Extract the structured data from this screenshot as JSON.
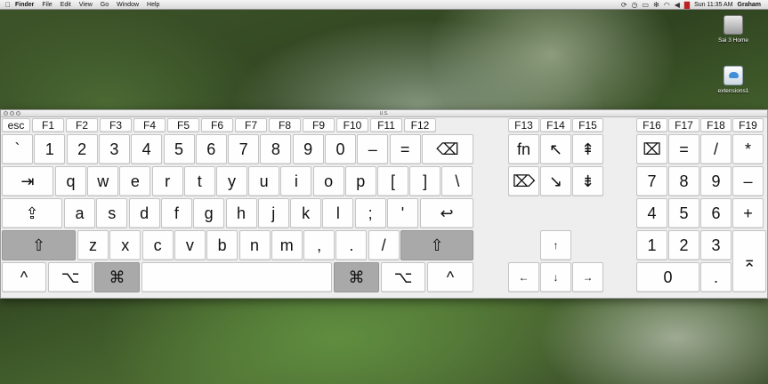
{
  "menubar": {
    "apple": "",
    "items": [
      "Finder",
      "File",
      "Edit",
      "View",
      "Go",
      "Window",
      "Help"
    ],
    "right_icons": [
      "sync-icon",
      "clock-icon",
      "display-icon",
      "bluetooth-icon",
      "wifi-icon",
      "volume-icon",
      "flag-icon"
    ],
    "right_glyphs": [
      "⟳",
      "◷",
      "▭",
      "✻",
      "◠",
      "◀",
      "▇"
    ],
    "time": "Sun 11:35 AM",
    "user": "Graham"
  },
  "desktop": {
    "icons": [
      {
        "label": "Sai 3 Home",
        "icon": "hard-drive-icon"
      },
      {
        "label": "extensions1",
        "icon": "icloud-drive-icon"
      }
    ]
  },
  "keyboard": {
    "title": "U.S.",
    "fn_row_main": [
      "esc",
      "F1",
      "F2",
      "F3",
      "F4",
      "F5",
      "F6",
      "F7",
      "F8",
      "F9",
      "F10",
      "F11",
      "F12"
    ],
    "fn_row_mid": [
      "F13",
      "F14",
      "F15"
    ],
    "fn_row_pad": [
      "F16",
      "F17",
      "F18",
      "F19"
    ],
    "row1": [
      "`",
      "1",
      "2",
      "3",
      "4",
      "5",
      "6",
      "7",
      "8",
      "9",
      "0",
      "–",
      "=",
      "⌫"
    ],
    "row2": [
      "⇥",
      "q",
      "w",
      "e",
      "r",
      "t",
      "y",
      "u",
      "i",
      "o",
      "p",
      "[",
      "]",
      "\\"
    ],
    "row3": [
      "⇪",
      "a",
      "s",
      "d",
      "f",
      "g",
      "h",
      "j",
      "k",
      "l",
      ";",
      "'",
      "↩"
    ],
    "row4": [
      "⇧",
      "z",
      "x",
      "c",
      "v",
      "b",
      "n",
      "m",
      ",",
      ".",
      "/",
      "⇧"
    ],
    "row5": [
      "^",
      "⌥",
      "⌘",
      "",
      "⌘",
      "⌥",
      "^"
    ],
    "nav_row1": [
      "fn",
      "↖",
      "⇞"
    ],
    "nav_row2": [
      "⌦",
      "↘",
      "⇟"
    ],
    "arrows": [
      "↑",
      "←",
      "↓",
      "→"
    ],
    "pad_row1": [
      "⌧",
      "=",
      "/",
      "*"
    ],
    "pad_row2": [
      "7",
      "8",
      "9",
      "–"
    ],
    "pad_row3": [
      "4",
      "5",
      "6",
      "+"
    ],
    "pad_row4": [
      "1",
      "2",
      "3"
    ],
    "pad_row5": [
      "0",
      "."
    ],
    "pad_enter": "⌅"
  }
}
